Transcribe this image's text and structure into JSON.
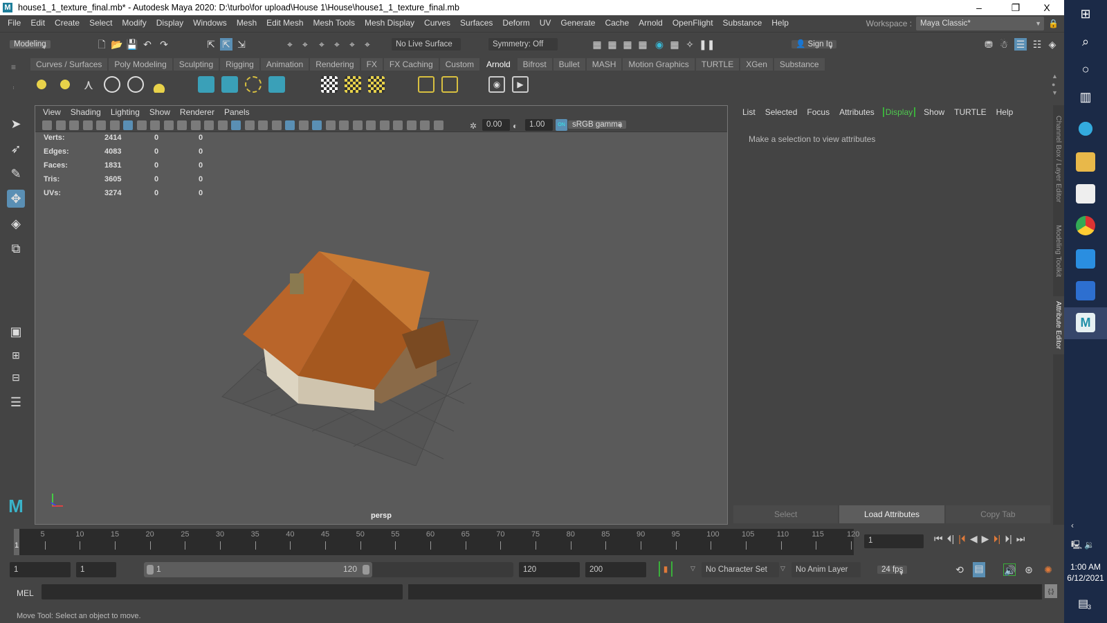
{
  "title": "house1_1_texture_final.mb* - Autodesk Maya 2020: D:\\turbo\\for upload\\House 1\\House\\house1_1_texture_final.mb",
  "window_controls": {
    "minimize": "–",
    "restore": "❐",
    "close": "X"
  },
  "menus": [
    "File",
    "Edit",
    "Create",
    "Select",
    "Modify",
    "Display",
    "Windows",
    "Mesh",
    "Edit Mesh",
    "Mesh Tools",
    "Mesh Display",
    "Curves",
    "Surfaces",
    "Deform",
    "UV",
    "Generate",
    "Cache",
    "Arnold",
    "OpenFlight",
    "Substance",
    "Help"
  ],
  "workspace": {
    "label": "Workspace :",
    "value": "Maya Classic*"
  },
  "status_line": {
    "mode": "Modeling",
    "live_surface": "No Live Surface",
    "symmetry": "Symmetry: Off",
    "sign_in": "Sign In"
  },
  "shelf_tabs": [
    "Curves / Surfaces",
    "Poly Modeling",
    "Sculpting",
    "Rigging",
    "Animation",
    "Rendering",
    "FX",
    "FX Caching",
    "Custom",
    "Arnold",
    "Bifrost",
    "Bullet",
    "MASH",
    "Motion Graphics",
    "TURTLE",
    "XGen",
    "Substance"
  ],
  "active_shelf": "Arnold",
  "viewport": {
    "menus": [
      "View",
      "Shading",
      "Lighting",
      "Show",
      "Renderer",
      "Panels"
    ],
    "exposure": "0.00",
    "gamma": "1.00",
    "color_mgmt": "sRGB gamma",
    "camera": "persp",
    "hud": [
      [
        "Verts:",
        "2414",
        "0",
        "0"
      ],
      [
        "Edges:",
        "4083",
        "0",
        "0"
      ],
      [
        "Faces:",
        "1831",
        "0",
        "0"
      ],
      [
        "Tris:",
        "3605",
        "0",
        "0"
      ],
      [
        "UVs:",
        "3274",
        "0",
        "0"
      ]
    ]
  },
  "attribute_editor": {
    "menus": [
      "List",
      "Selected",
      "Focus",
      "Attributes",
      "Display",
      "Show",
      "TURTLE",
      "Help"
    ],
    "message": "Make a selection to view attributes",
    "buttons": [
      "Select",
      "Load Attributes",
      "Copy Tab"
    ]
  },
  "side_tabs": [
    "Channel Box / Layer Editor",
    "Modeling Toolkit",
    "Attribute Editor"
  ],
  "timeline": {
    "start": 1,
    "end": 120,
    "current": "1",
    "labels": [
      5,
      10,
      15,
      20,
      25,
      30,
      35,
      40,
      45,
      50,
      55,
      60,
      65,
      70,
      75,
      80,
      85,
      90,
      95,
      100,
      105,
      110,
      115,
      120
    ]
  },
  "range": {
    "start": "1",
    "play_start": "1",
    "range_start": "1",
    "range_end": "120",
    "play_end": "120",
    "end": "200",
    "character_set": "No Character Set",
    "anim_layer": "No Anim Layer",
    "fps": "24 fps"
  },
  "command": {
    "lang": "MEL"
  },
  "help_line": "Move Tool: Select an object to move.",
  "taskbar": {
    "time": "1:00 AM",
    "date": "6/12/2021",
    "notifications": "3"
  }
}
